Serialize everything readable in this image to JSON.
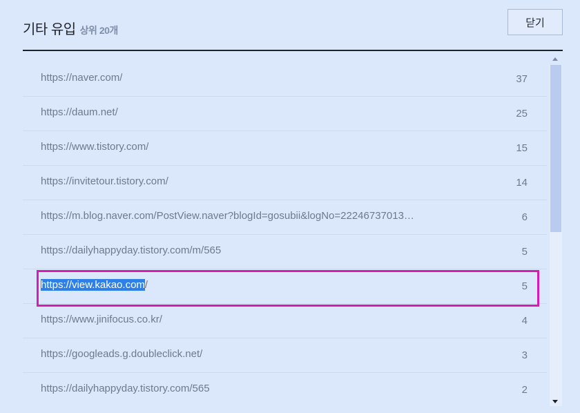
{
  "header": {
    "title": "기타 유입",
    "subtitle": "상위 20개",
    "close_label": "닫기"
  },
  "rows": [
    {
      "url": "https://naver.com/",
      "count": "37"
    },
    {
      "url": "https://daum.net/",
      "count": "25"
    },
    {
      "url": "https://www.tistory.com/",
      "count": "15"
    },
    {
      "url": "https://invitetour.tistory.com/",
      "count": "14"
    },
    {
      "url": "https://m.blog.naver.com/PostView.naver?blogId=gosubii&logNo=22246737013…",
      "count": "6"
    },
    {
      "url": "https://dailyhappyday.tistory.com/m/565",
      "count": "5"
    },
    {
      "url_selected": "https://view.kakao.com",
      "url_rest": "/",
      "count": "5"
    },
    {
      "url": "https://www.jinifocus.co.kr/",
      "count": "4"
    },
    {
      "url": "https://googleads.g.doubleclick.net/",
      "count": "3"
    },
    {
      "url": "https://dailyhappyday.tistory.com/565",
      "count": "2"
    }
  ],
  "colors": {
    "background": "#dbe7fb",
    "highlight_border": "#d21eb4",
    "text_selection": "#2f80e6",
    "scroll_thumb": "#b9cbee"
  },
  "scroll": {
    "position": 0
  }
}
